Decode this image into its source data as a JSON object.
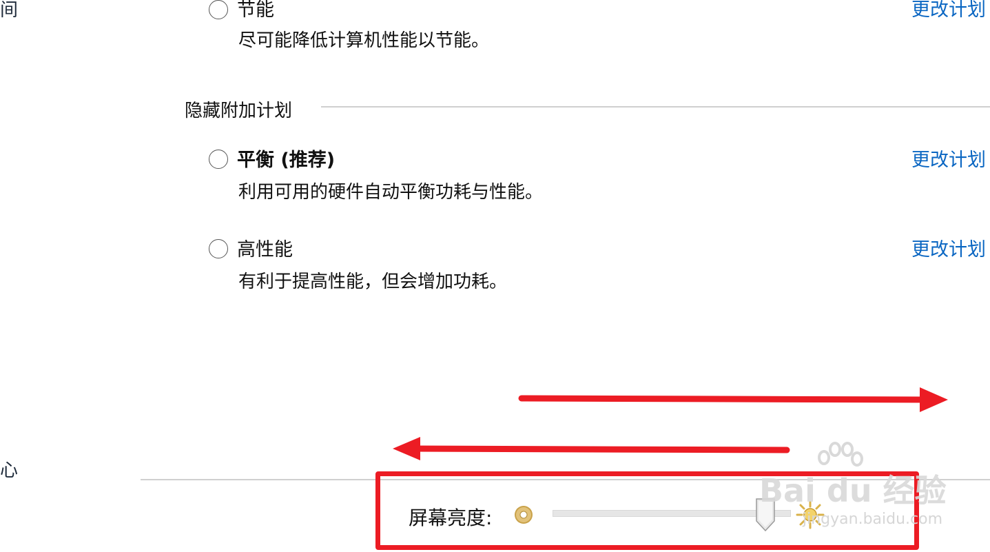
{
  "sidebar": {
    "item_top_fragment": "时间",
    "item_bottom_fragment": "中心"
  },
  "plans": {
    "top": {
      "name": "节能",
      "description": "尽可能降低计算机性能以节能。",
      "link": "更改计划"
    },
    "hidden_section": {
      "heading": "隐藏附加计划",
      "items": [
        {
          "name": "平衡 (推荐)",
          "description": "利用可用的硬件自动平衡功耗与性能。",
          "link": "更改计划"
        },
        {
          "name": "高性能",
          "description": "有利于提高性能，但会增加功耗。",
          "link": "更改计划"
        }
      ]
    }
  },
  "brightness": {
    "label": "屏幕亮度:",
    "level_percent": 93,
    "low_icon": "dim-sun-icon",
    "high_icon": "bright-sun-icon"
  },
  "annotations": {
    "arrow_color": "#ec1c24",
    "box_color": "#ec1c24",
    "arrows": [
      "arrow-right",
      "arrow-left"
    ]
  },
  "watermark": {
    "brand": "Bai du 经验",
    "url": "jingyan.baidu.com"
  }
}
